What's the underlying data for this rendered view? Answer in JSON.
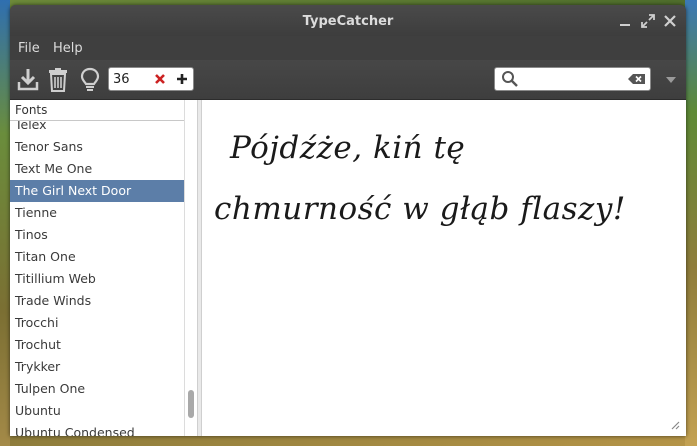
{
  "window": {
    "title": "TypeCatcher"
  },
  "menubar": {
    "file": "File",
    "help": "Help"
  },
  "toolbar": {
    "download_icon": "download-icon",
    "delete_icon": "trash-icon",
    "info_icon": "lightbulb-icon",
    "font_size": "36",
    "clear_icon": "x-icon",
    "add_icon": "plus-icon",
    "search_placeholder": "",
    "search_value": ""
  },
  "font_list": {
    "header": "Fonts",
    "items": [
      "Telex",
      "Tenor Sans",
      "Text Me One",
      "The Girl Next Door",
      "Tienne",
      "Tinos",
      "Titan One",
      "Titillium Web",
      "Trade Winds",
      "Trocchi",
      "Trochut",
      "Trykker",
      "Tulpen One",
      "Ubuntu",
      "Ubuntu Condensed"
    ],
    "selected": "The Girl Next Door"
  },
  "preview": {
    "line1": "Pójdźże, kiń tę",
    "line2": "chmurność w głąb flaszy!"
  },
  "colors": {
    "selection": "#5c7ea8",
    "toolbar_bg": "#3e3e3e",
    "clear_red": "#cc2222"
  }
}
